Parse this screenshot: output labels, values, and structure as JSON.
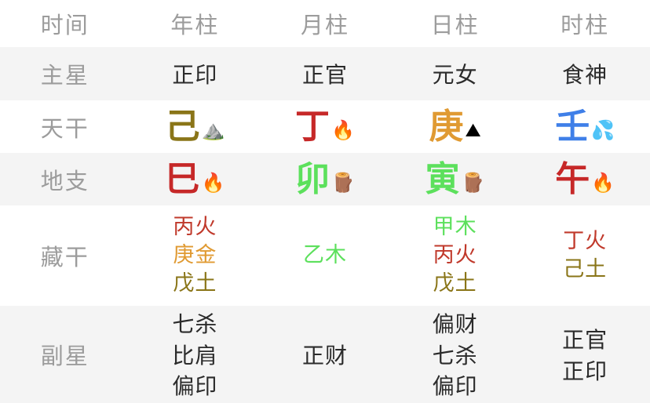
{
  "table": {
    "header": {
      "row_label": "时间",
      "columns": [
        "年柱",
        "月柱",
        "日柱",
        "时柱"
      ]
    },
    "rows": [
      {
        "key": "main_star",
        "label": "主星",
        "cells": [
          "正印",
          "正官",
          "元女",
          "食神"
        ]
      },
      {
        "key": "heavenly_stem",
        "label": "天干",
        "cells": [
          {
            "char": "己",
            "color": "#8a7518",
            "element_icon": "earth-mountain-icon",
            "emoji": "⛰️"
          },
          {
            "char": "丁",
            "color": "#c62828",
            "element_icon": "fire-icon",
            "emoji": "🔥"
          },
          {
            "char": "庚",
            "color": "#e09a32",
            "element_icon": "metal-pyramid-icon",
            "emoji": "⛰"
          },
          {
            "char": "壬",
            "color": "#3f7fe8",
            "element_icon": "water-droplet-icon",
            "emoji": "💦"
          }
        ]
      },
      {
        "key": "earthly_branch",
        "label": "地支",
        "cells": [
          {
            "char": "巳",
            "color": "#c62828",
            "element_icon": "fire-icon",
            "emoji": "🔥"
          },
          {
            "char": "卯",
            "color": "#5ce05c",
            "element_icon": "wood-log-icon",
            "emoji": "🪵"
          },
          {
            "char": "寅",
            "color": "#5ce05c",
            "element_icon": "wood-log-icon",
            "emoji": "🪵"
          },
          {
            "char": "午",
            "color": "#c62828",
            "element_icon": "fire-icon",
            "emoji": "🔥"
          }
        ]
      },
      {
        "key": "hidden_stems",
        "label": "藏干",
        "cells": [
          [
            {
              "text": "丙火",
              "color": "#c0392b"
            },
            {
              "text": "庚金",
              "color": "#e09a32"
            },
            {
              "text": "戊土",
              "color": "#8a7518"
            }
          ],
          [
            {
              "text": "乙木",
              "color": "#5ce05c"
            }
          ],
          [
            {
              "text": "甲木",
              "color": "#5ce05c"
            },
            {
              "text": "丙火",
              "color": "#c0392b"
            },
            {
              "text": "戊土",
              "color": "#8a7518"
            }
          ],
          [
            {
              "text": "丁火",
              "color": "#c0392b"
            },
            {
              "text": "己土",
              "color": "#8a7518"
            }
          ]
        ]
      },
      {
        "key": "minor_stars",
        "label": "副星",
        "cells": [
          [
            "七杀",
            "比肩",
            "偏印"
          ],
          [
            "正财"
          ],
          [
            "偏财",
            "七杀",
            "偏印"
          ],
          [
            "正官",
            "正印"
          ]
        ]
      }
    ]
  },
  "colors": {
    "row_shade": "#f4f4f4",
    "row_light": "#ffffff",
    "label_text": "#9c9c9c",
    "body_text": "#2b2b2b",
    "fire": "#c62828",
    "wood": "#5ce05c",
    "earth": "#8a7518",
    "metal": "#e09a32",
    "water": "#3f7fe8"
  }
}
